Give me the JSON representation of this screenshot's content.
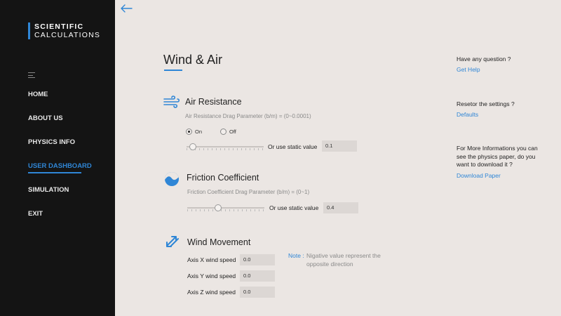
{
  "brand": {
    "line1": "SCIENTIFIC",
    "line2": "CALCULATIONS"
  },
  "nav": {
    "items": [
      {
        "label": "HOME"
      },
      {
        "label": "ABOUT US"
      },
      {
        "label": "PHYSICS INFO"
      },
      {
        "label": "USER DASHBOARD",
        "active": true
      },
      {
        "label": "SIMULATION"
      },
      {
        "label": "EXIT"
      }
    ]
  },
  "page": {
    "title": "Wind & Air"
  },
  "air_resistance": {
    "title": "Air Resistance",
    "subtitle": "Air Resistance Drag Parameter (b/m) = (0~0.0001)",
    "radio_on": "On",
    "radio_off": "Off",
    "selected": "On",
    "slider_level": 0.08,
    "static_label": "Or use static value",
    "static_value": "0.1"
  },
  "friction": {
    "title": "Friction Coefficient",
    "subtitle": "Friction Coefficient Drag Parameter (b/m) = (0~1)",
    "slider_level": 0.4,
    "static_label": "Or use static value",
    "static_value": "0.4"
  },
  "wind": {
    "title": "Wind Movement",
    "x_label": "Axis X wind speed",
    "x_value": "0.0",
    "y_label": "Axis Y wind speed",
    "y_value": "0.0",
    "z_label": "Axis Z wind speed",
    "z_value": "0.0",
    "note_label": "Note :",
    "note_text": "Nigative value represent the opposite direction"
  },
  "right": {
    "help_question": "Have any question ?",
    "help_link": "Get Help",
    "reset_question": "Resetor the settings ?",
    "reset_link": "Defaults",
    "paper_question": "For More Informations you can see the physics paper, do you want to download it ?",
    "paper_link": "Download Paper"
  },
  "colors": {
    "accent": "#2f86d6",
    "sidebar": "#141414",
    "background": "#ebe6e3"
  },
  "icons": {
    "back": "arrow-left-icon",
    "menu": "hamburger-icon",
    "air": "wind-icon",
    "friction": "wave-circle-icon",
    "wind": "swap-arrows-icon"
  }
}
